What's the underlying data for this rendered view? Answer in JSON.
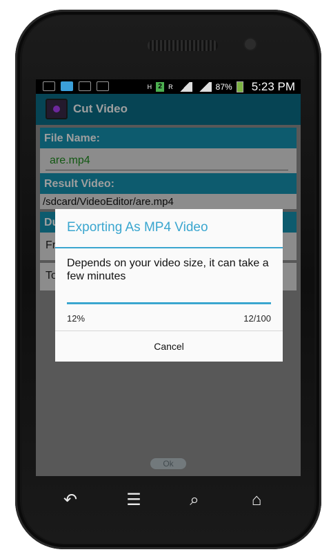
{
  "status_bar": {
    "battery_percent": "87%",
    "time": "5:23 PM",
    "h_label": "H",
    "r_label": "R",
    "network_badge": "2",
    "icons": [
      "keyboard-icon",
      "wifi-icon",
      "image-icon",
      "briefcase-icon",
      "h-arrows-icon",
      "network-2-icon",
      "signal-icon",
      "signal-icon",
      "battery-icon"
    ]
  },
  "app_bar": {
    "title": "Cut Video",
    "icon": "video-editor-app-icon"
  },
  "form": {
    "file_name_label": "File Name:",
    "file_name_value": "are.mp4",
    "result_video_label": "Result Video:",
    "result_video_path": "/sdcard/VideoEditor/are.mp4",
    "duration_label_partial": "Du",
    "from_label_partial": "Fr",
    "to_label_partial": "To",
    "ok_button": "Ok"
  },
  "dialog": {
    "title": "Exporting As MP4 Video",
    "message": "Depends on your video size, it can take a few minutes",
    "progress_percent": "12%",
    "progress_count": "12/100",
    "progress_fraction": 0.12,
    "cancel_label": "Cancel"
  },
  "navigation": {
    "icons": [
      "back-icon",
      "menu-icon",
      "search-icon",
      "home-icon"
    ]
  },
  "colors": {
    "accent": "#3aa6cf",
    "section_header": "#1693b2",
    "app_bar": "#0b6f88",
    "file_name_text": "#1f8f1f"
  }
}
